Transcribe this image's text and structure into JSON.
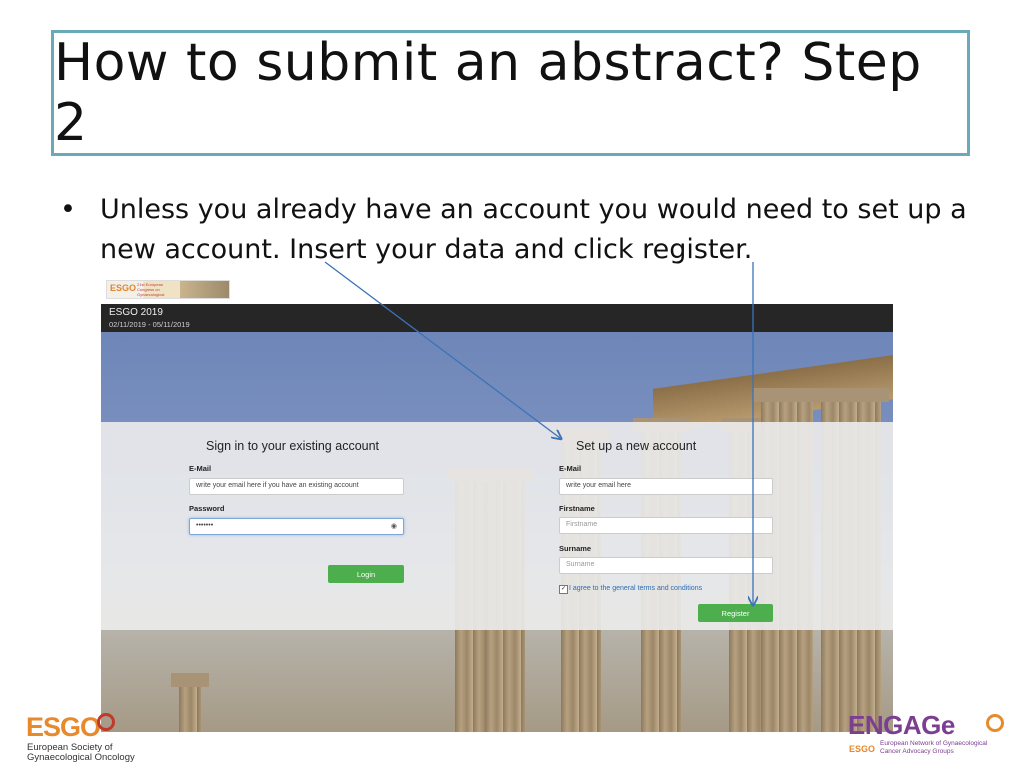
{
  "slide": {
    "title": "How to submit an abstract? Step 2",
    "bullet": "Unless you already have an account you would need to set up a new account. Insert your data and click register."
  },
  "screenshot": {
    "header": {
      "event_name": "ESGO 2019",
      "dates": "02/11/2019 - 05/11/2019"
    },
    "signin": {
      "title": "Sign in to your existing account",
      "email_label": "E-Mail",
      "email_value": "write your email here if you have an existing account",
      "password_label": "Password",
      "password_value": "•••••••",
      "login_label": "Login"
    },
    "register": {
      "title": "Set up a new account",
      "email_label": "E-Mail",
      "email_value": "write your email here",
      "firstname_label": "Firstname",
      "firstname_placeholder": "Firstname",
      "surname_label": "Surname",
      "surname_placeholder": "Surname",
      "agree_text": "I agree to the general terms and conditions",
      "register_label": "Register"
    }
  },
  "logos": {
    "esgo_name": "ESGO",
    "esgo_line1": "European Society of",
    "esgo_line2": "Gynaecological Oncology",
    "engage_name": "ENGAGe",
    "engage_tag": "ESGO",
    "engage_line1": "European Network of Gynaecological",
    "engage_line2": "Cancer Advocacy Groups"
  },
  "colors": {
    "title_border": "#6aaab8",
    "button_green": "#4cae4c",
    "arrow_blue": "#3b73b9",
    "esgo_orange": "#e8892b",
    "engage_purple": "#7b3f91"
  }
}
